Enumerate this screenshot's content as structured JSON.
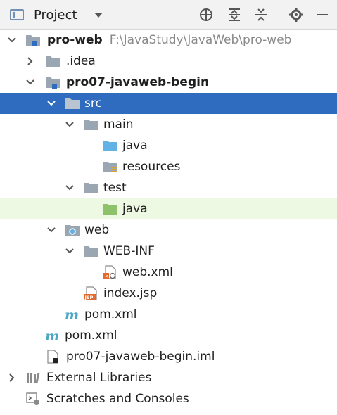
{
  "header": {
    "title": "Project"
  },
  "tree": {
    "root_label": "pro-web",
    "root_path": "F:\\JavaStudy\\JavaWeb\\pro-web",
    "idea": ".idea",
    "module": "pro07-javaweb-begin",
    "src": "src",
    "main": "main",
    "main_java": "java",
    "resources": "resources",
    "test": "test",
    "test_java": "java",
    "web": "web",
    "webinf": "WEB-INF",
    "webxml": "web.xml",
    "indexjsp": "index.jsp",
    "module_pom": "pom.xml",
    "root_pom": "pom.xml",
    "iml": "pro07-javaweb-begin.iml",
    "ext_libs": "External Libraries",
    "scratches": "Scratches and Consoles"
  },
  "colors": {
    "selection": "#2f6cc0",
    "test_highlight": "#eef9e3",
    "folder": "#9aa7b3",
    "source_folder": "#63b2e6",
    "test_folder": "#8dc26a",
    "maven": "#4ba7c4"
  }
}
